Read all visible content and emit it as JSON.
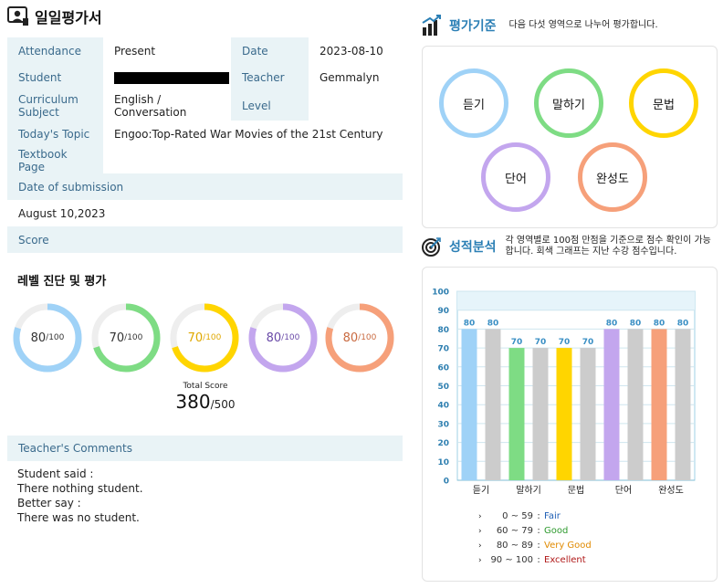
{
  "page": {
    "title": "일일평가서"
  },
  "info": {
    "attendance_label": "Attendance",
    "attendance_value": "Present",
    "date_label": "Date",
    "date_value": "2023-08-10",
    "student_label": "Student",
    "teacher_label": "Teacher",
    "teacher_value": "Gemmalyn",
    "curriculum_label": "Curriculum Subject",
    "curriculum_value": "English / Conversation",
    "level_label": "Level",
    "level_value": "",
    "topic_label": "Today's Topic",
    "topic_value": "Engoo:Top-Rated War Movies of the 21st Century",
    "textbook_label": "Textbook Page",
    "textbook_value": "",
    "submission_label": "Date of submission",
    "submission_value": "August 10,2023",
    "score_label": "Score"
  },
  "evaluation": {
    "heading": "레벨 진단 및 평가",
    "max_label": "/100",
    "rings": [
      {
        "value": "80",
        "score": 80,
        "color": "#9fd2f7",
        "text_color": "#333333"
      },
      {
        "value": "70",
        "score": 70,
        "color": "#7edc84",
        "text_color": "#333333"
      },
      {
        "value": "70",
        "score": 70,
        "color": "#ffd500",
        "text_color": "#e0a800"
      },
      {
        "value": "80",
        "score": 80,
        "color": "#c3a6ee",
        "text_color": "#6a4aa8"
      },
      {
        "value": "80",
        "score": 80,
        "color": "#f6a07a",
        "text_color": "#c96a40"
      }
    ],
    "total_label": "Total Score",
    "total_value": "380",
    "total_max": "/500"
  },
  "comments": {
    "label": "Teacher's Comments",
    "lines": [
      "Student said :",
      "There nothing student.",
      "Better say :",
      "There was no student."
    ]
  },
  "criteria": {
    "title": "평가기준",
    "description": "다음 다섯 영역으로 나누어 평가합니다.",
    "items": [
      {
        "label": "듣기",
        "color": "#9fd2f7"
      },
      {
        "label": "말하기",
        "color": "#7edc84"
      },
      {
        "label": "문법",
        "color": "#ffd500"
      },
      {
        "label": "단어",
        "color": "#c3a6ee"
      },
      {
        "label": "완성도",
        "color": "#f6a07a"
      }
    ]
  },
  "analysis": {
    "title": "성적분석",
    "description_line1": "각 영역별로 100점 만점을 기준으로 점수 확인이 가능",
    "description_line2": "합니다. 회색 그래프는 지난 수강 점수입니다."
  },
  "chart_data": {
    "type": "bar",
    "categories": [
      "듣기",
      "말하기",
      "문법",
      "단어",
      "완성도"
    ],
    "series": [
      {
        "values": [
          80,
          70,
          70,
          80,
          80
        ],
        "colors": [
          "#9fd2f7",
          "#7edc84",
          "#ffd500",
          "#c3a6ee",
          "#f6a07a"
        ]
      },
      {
        "values": [
          80,
          70,
          70,
          80,
          80
        ],
        "color": "#cccccc"
      }
    ],
    "ylim": [
      0,
      100
    ],
    "yticks": [
      0,
      10,
      20,
      30,
      40,
      50,
      60,
      70,
      80,
      90,
      100
    ],
    "grid": true,
    "label_color": "#3a8fc4"
  },
  "legend": [
    {
      "range": "0 ~  59",
      "grade": "Fair",
      "color": "#1f5fb5"
    },
    {
      "range": "60 ~  79",
      "grade": "Good",
      "color": "#2e9a2e"
    },
    {
      "range": "80 ~  89",
      "grade": "Very Good",
      "color": "#e08a00"
    },
    {
      "range": "90 ~ 100",
      "grade": "Excellent",
      "color": "#b01818"
    }
  ]
}
